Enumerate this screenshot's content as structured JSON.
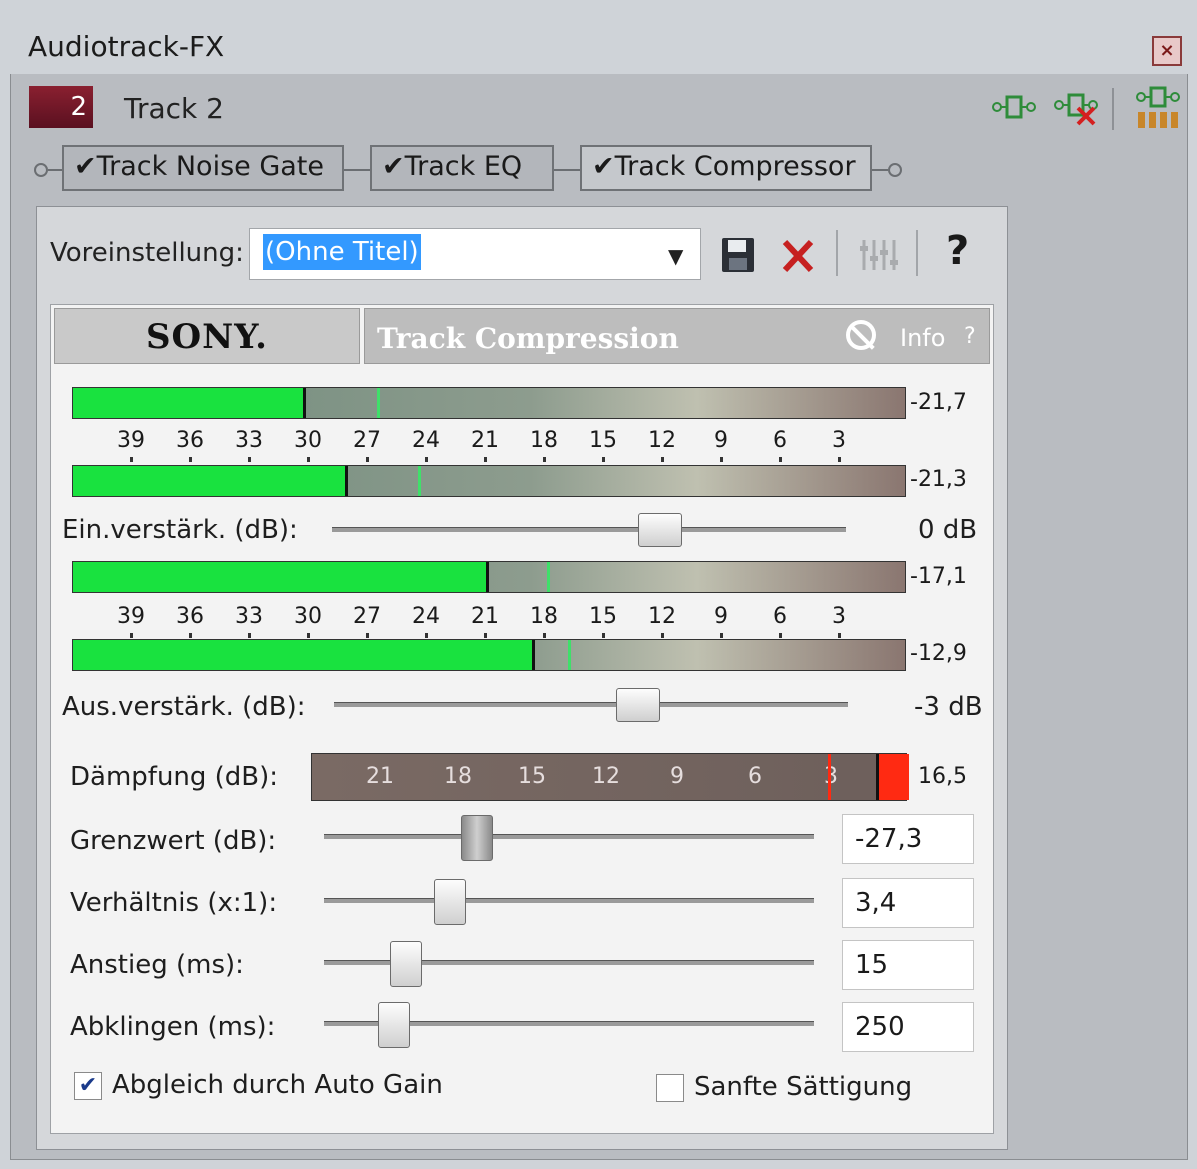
{
  "window": {
    "title": "Audiotrack-FX",
    "close_icon": "close-icon"
  },
  "track": {
    "number": "2",
    "name": "Track 2"
  },
  "toolbar": {
    "icons": [
      "plugin-chain-icon",
      "remove-plugin-icon",
      "plugin-chooser-icon"
    ]
  },
  "plugins": [
    {
      "label": "Track Noise Gate",
      "checked": true
    },
    {
      "label": "Track EQ",
      "checked": true
    },
    {
      "label": "Track Compressor",
      "checked": true,
      "active": true
    }
  ],
  "preset": {
    "label": "Voreinstellung:",
    "value": "(Ohne Titel)",
    "icons": [
      "save-icon",
      "delete-icon",
      "mixer-icon",
      "help-icon"
    ],
    "help_glyph": "?"
  },
  "plugin_header": {
    "brand": "SONY.",
    "title": "Track Compression",
    "info": "Info",
    "help": "?"
  },
  "meter_scale": [
    "39",
    "36",
    "33",
    "30",
    "27",
    "24",
    "21",
    "18",
    "15",
    "12",
    "9",
    "6",
    "3"
  ],
  "input_meters": [
    {
      "value": "-21,7",
      "level": 0.28,
      "peak": 0.365
    },
    {
      "value": "-21,3",
      "level": 0.33,
      "peak": 0.415
    }
  ],
  "input_gain": {
    "label": "Ein.verstärk. (dB):",
    "value": "0 dB",
    "position": 0.65
  },
  "output_meters": [
    {
      "value": "-17,1",
      "level": 0.5,
      "peak": 0.57
    },
    {
      "value": "-12,9",
      "level": 0.555,
      "peak": 0.595
    }
  ],
  "output_gain": {
    "label": "Aus.verstärk. (dB):",
    "value": "-3 dB",
    "position": 0.6
  },
  "attenuation": {
    "label": "Dämpfung (dB):",
    "scale": [
      "21",
      "18",
      "15",
      "12",
      "9",
      "6",
      "3"
    ],
    "value": "16,5"
  },
  "params": [
    {
      "label": "Grenzwert (dB):",
      "value": "-27,3",
      "position": 0.3
    },
    {
      "label": "Verhältnis (x:1):",
      "value": "3,4",
      "position": 0.24
    },
    {
      "label": "Anstieg (ms):",
      "value": "15",
      "position": 0.145
    },
    {
      "label": "Abklingen (ms):",
      "value": "250",
      "position": 0.117
    }
  ],
  "options": [
    {
      "label": "Abgleich durch Auto Gain",
      "checked": true
    },
    {
      "label": "Sanfte Sättigung",
      "checked": false
    }
  ],
  "colors": {
    "meter_green": "#19e23f",
    "attenuation_red": "#ff2a12",
    "track_badge": "#7a1a2a"
  }
}
